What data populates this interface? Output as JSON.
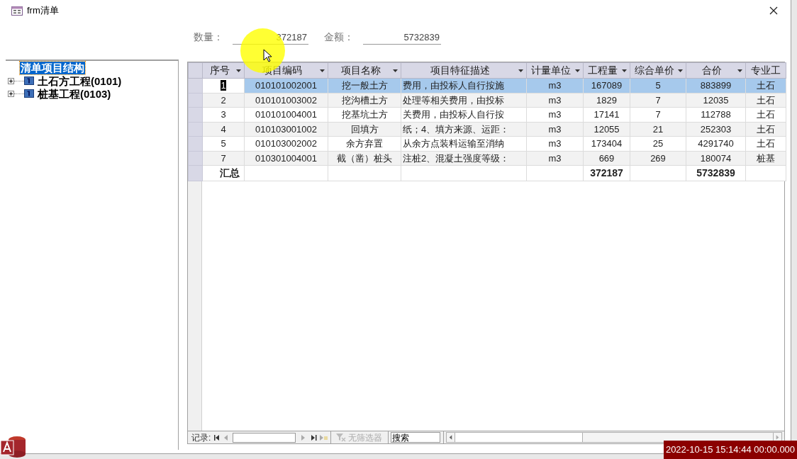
{
  "window": {
    "title": "frm清单"
  },
  "summary": [
    {
      "label": "数量：",
      "value": "372187"
    },
    {
      "label": "金额：",
      "value": "5732839"
    }
  ],
  "tree": {
    "root": {
      "label": "清单项目结构",
      "selected": true
    },
    "children": [
      {
        "label": "土石方工程(0101)",
        "expanded": false
      },
      {
        "label": "桩基工程(0103)",
        "expanded": false
      }
    ]
  },
  "table": {
    "columns": [
      {
        "label": "序号",
        "filter_arrow": true
      },
      {
        "label": "项目编码",
        "filter_arrow": true
      },
      {
        "label": "项目名称",
        "filter_arrow": true
      },
      {
        "label": "项目特征描述",
        "filter_arrow": true
      },
      {
        "label": "计量单位",
        "filter_arrow": true
      },
      {
        "label": "工程量",
        "filter_arrow": true
      },
      {
        "label": "综合单价",
        "filter_arrow": true
      },
      {
        "label": "合价",
        "filter_arrow": true
      },
      {
        "label": "专业工",
        "filter_arrow": false
      }
    ],
    "rows": [
      {
        "selected": true,
        "cells": [
          "1",
          "010101002001",
          "挖一般土方",
          "费用，由投标人自行按施",
          "m3",
          "167089",
          "5",
          "883899",
          "土石"
        ]
      },
      {
        "selected": false,
        "cells": [
          "2",
          "010101003002",
          "挖沟槽土方",
          "处理等相关费用，由投标",
          "m3",
          "1829",
          "7",
          "12035",
          "土石"
        ]
      },
      {
        "selected": false,
        "cells": [
          "3",
          "010101004001",
          "挖基坑土方",
          "关费用，由投标人自行按",
          "m3",
          "17141",
          "7",
          "112788",
          "土石"
        ]
      },
      {
        "selected": false,
        "cells": [
          "4",
          "010103001002",
          "回填方",
          "纸；4、填方来源、运距：",
          "m3",
          "12055",
          "21",
          "252303",
          "土石"
        ]
      },
      {
        "selected": false,
        "cells": [
          "5",
          "010103002002",
          "余方弃置",
          "从余方点装料运输至消纳",
          "m3",
          "173404",
          "25",
          "4291740",
          "土石"
        ]
      },
      {
        "selected": false,
        "cells": [
          "7",
          "010301004001",
          "截（凿）桩头",
          "注桩2、混凝土强度等级：",
          "m3",
          "669",
          "269",
          "180074",
          "桩基"
        ]
      }
    ],
    "total": {
      "label": "汇总",
      "quantity": "372187",
      "amount": "5732839"
    }
  },
  "navigation": {
    "label": "记录:",
    "filter": "无筛选器",
    "search": "搜索"
  },
  "timestamp": "2022-10-15 15:14:44 00:00.000"
}
